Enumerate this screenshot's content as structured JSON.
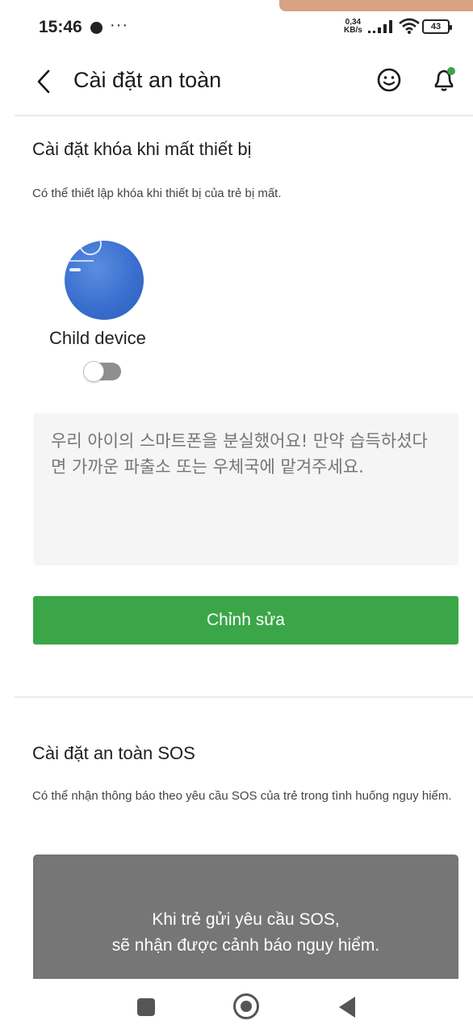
{
  "status_bar": {
    "time": "15:46",
    "more": "···",
    "net_speed_value": "0,34",
    "net_speed_unit": "KB/s",
    "battery": "43"
  },
  "header": {
    "title": "Cài đặt an toàn",
    "back_icon": "chevron-left-icon",
    "smile_icon": "smile-icon",
    "bell_icon": "bell-icon",
    "bell_badge_color": "#3aa648"
  },
  "lock_section": {
    "title": "Cài đặt khóa khi mất thiết bị",
    "description": "Có thể thiết lập khóa khi thiết bị của trẻ bị mất.",
    "device_name": "Child device",
    "toggle_on": false,
    "message_placeholder": "우리 아이의 스마트폰을 분실했어요! 만약 습득하셨다면 가까운 파출소 또는 우체국에 맡겨주세요.",
    "edit_button": "Chỉnh sửa",
    "accent_color": "#3aa648"
  },
  "sos_section": {
    "title": "Cài đặt an toàn SOS",
    "description": "Có thể nhận thông báo theo yêu cầu SOS của trẻ trong tình huống nguy hiểm.",
    "banner_line1": "Khi trẻ gửi yêu cầu SOS,",
    "banner_line2": "sẽ nhận được cảnh báo nguy hiểm."
  },
  "nav_bar": {
    "recents_icon": "square-icon",
    "home_icon": "circle-home-icon",
    "back_icon": "triangle-back-icon"
  }
}
